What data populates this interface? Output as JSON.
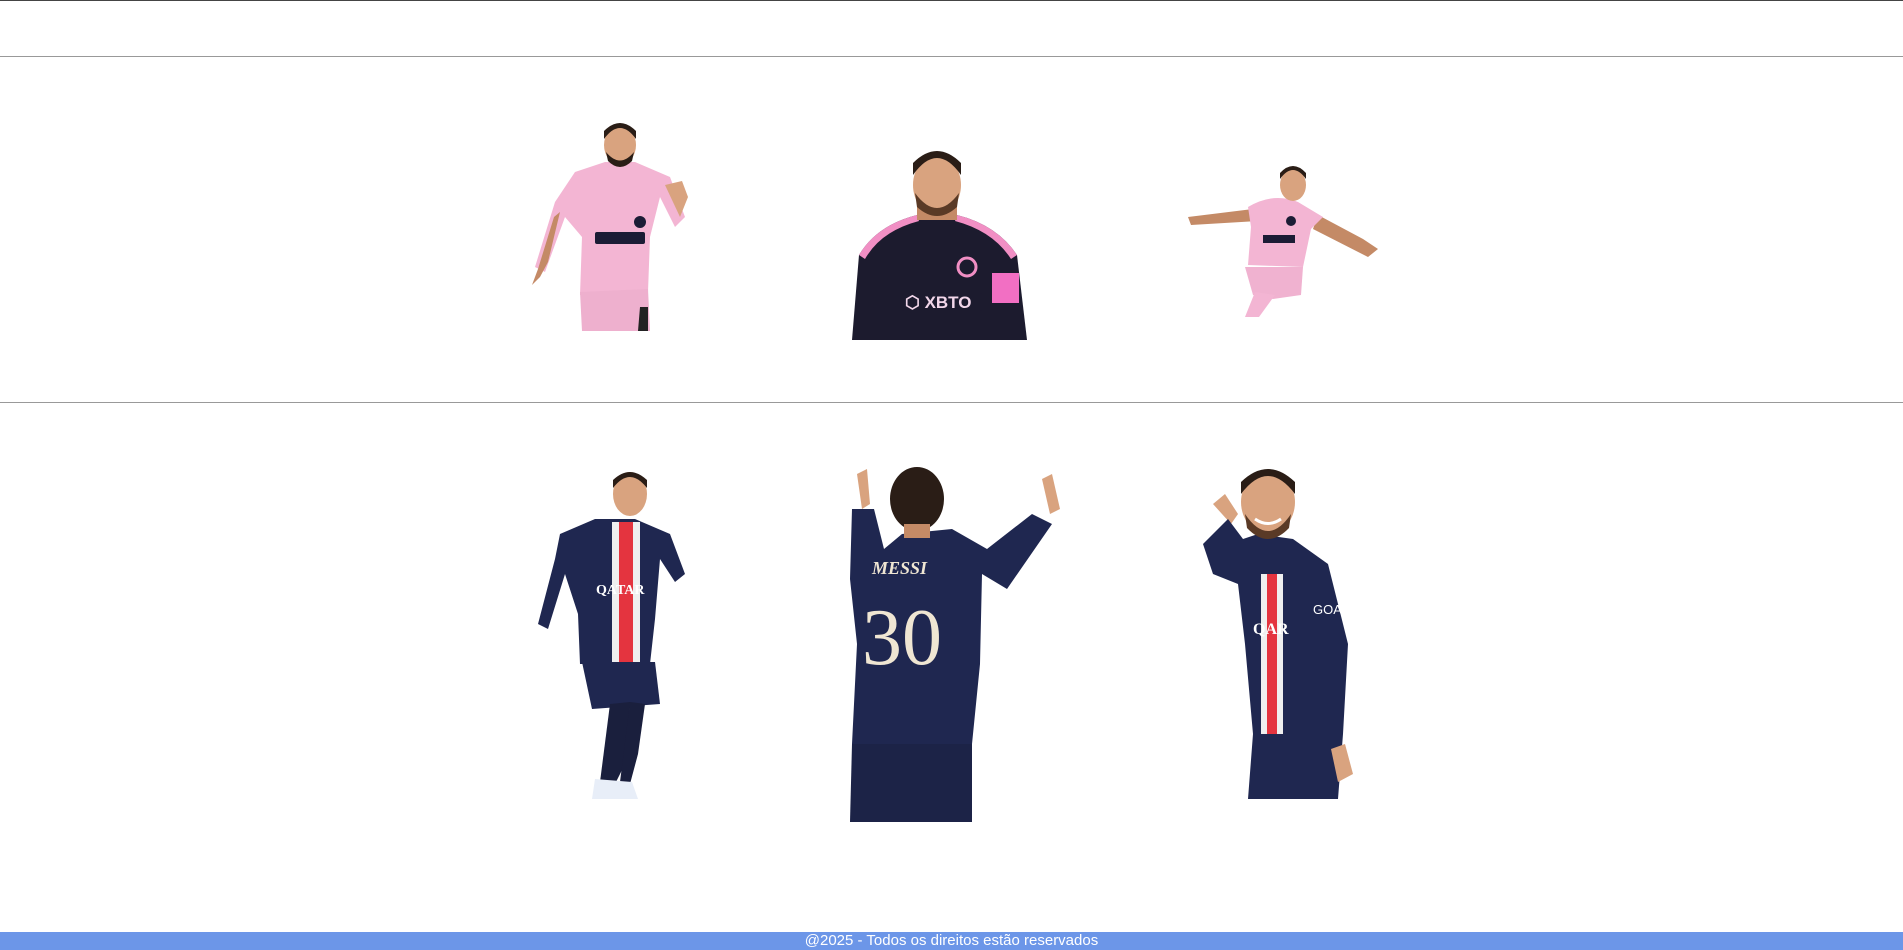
{
  "gallery": {
    "rows": [
      {
        "photos": [
          {
            "subject": "player-pink-kit-running",
            "kit": "#f3b5d3",
            "kit_trim": "#1b1c35",
            "skin": "#d9a37f",
            "hair": "#2a1d16"
          },
          {
            "subject": "player-black-kit-portrait",
            "kit": "#1c1b2e",
            "kit_trim": "#f18fc4",
            "skin": "#d9a37f",
            "hair": "#2a1d16"
          },
          {
            "subject": "player-pink-kit-celebrating",
            "kit": "#f3b5d3",
            "kit_trim": "#1b1c35",
            "skin": "#d9a37f",
            "hair": "#2a1d16"
          }
        ]
      },
      {
        "photos": [
          {
            "subject": "player-navy-kit-running",
            "kit": "#1f2750",
            "kit_trim": "#e4343f",
            "skin": "#d9a37f",
            "hair": "#2a1d16"
          },
          {
            "subject": "player-navy-kit-back-pointing",
            "kit": "#1f2750",
            "kit_trim": "#efe6d3",
            "skin": "#d9a37f",
            "hair": "#2a1d16"
          },
          {
            "subject": "player-navy-kit-smiling",
            "kit": "#1f2750",
            "kit_trim": "#e4343f",
            "skin": "#d9a37f",
            "hair": "#2a1d16"
          }
        ]
      }
    ]
  },
  "footer": {
    "text": "@2025 - Todos os direitos estão reservados",
    "background": "#6c96e8"
  }
}
